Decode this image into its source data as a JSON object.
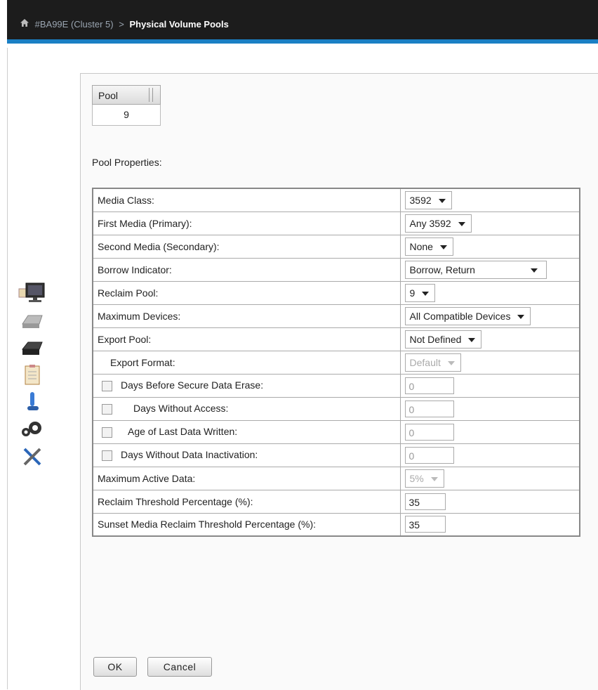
{
  "breadcrumb": {
    "cluster": "#BA99E (Cluster 5)",
    "separator": ">",
    "current": "Physical Volume Pools"
  },
  "pool_grid": {
    "header": "Pool",
    "value": "9"
  },
  "section_label": "Pool Properties:",
  "properties": {
    "media_class": {
      "label": "Media Class:",
      "value": "3592"
    },
    "first_media": {
      "label": "First Media (Primary):",
      "value": "Any 3592"
    },
    "second_media": {
      "label": "Second Media (Secondary):",
      "value": "None"
    },
    "borrow_indicator": {
      "label": "Borrow Indicator:",
      "value": "Borrow, Return"
    },
    "reclaim_pool": {
      "label": "Reclaim Pool:",
      "value": "9"
    },
    "maximum_devices": {
      "label": "Maximum Devices:",
      "value": "All Compatible Devices"
    },
    "export_pool": {
      "label": "Export Pool:",
      "value": "Not Defined"
    },
    "export_format": {
      "label": "Export Format:",
      "value": "Default"
    },
    "days_before_erase": {
      "label": "Days Before Secure Data Erase:",
      "value": "0"
    },
    "days_without_access": {
      "label": "Days Without Access:",
      "value": "0"
    },
    "age_last_written": {
      "label": "Age of Last Data Written:",
      "value": "0"
    },
    "days_without_inactivation": {
      "label": "Days Without Data Inactivation:",
      "value": "0"
    },
    "maximum_active_data": {
      "label": "Maximum Active Data:",
      "value": "5%"
    },
    "reclaim_threshold": {
      "label": "Reclaim Threshold Percentage (%):",
      "value": "35"
    },
    "sunset_reclaim_threshold": {
      "label": "Sunset Media Reclaim Threshold Percentage (%):",
      "value": "35"
    }
  },
  "buttons": {
    "ok": "OK",
    "cancel": "Cancel"
  },
  "icons": [
    "monitor-icon",
    "disk-drive-icon",
    "tape-drive-icon",
    "clipboard-icon",
    "user-icon",
    "gears-icon",
    "tools-icon"
  ],
  "colors": {
    "topbar": "#1c1c1c",
    "accent": "#1a7fc4"
  }
}
